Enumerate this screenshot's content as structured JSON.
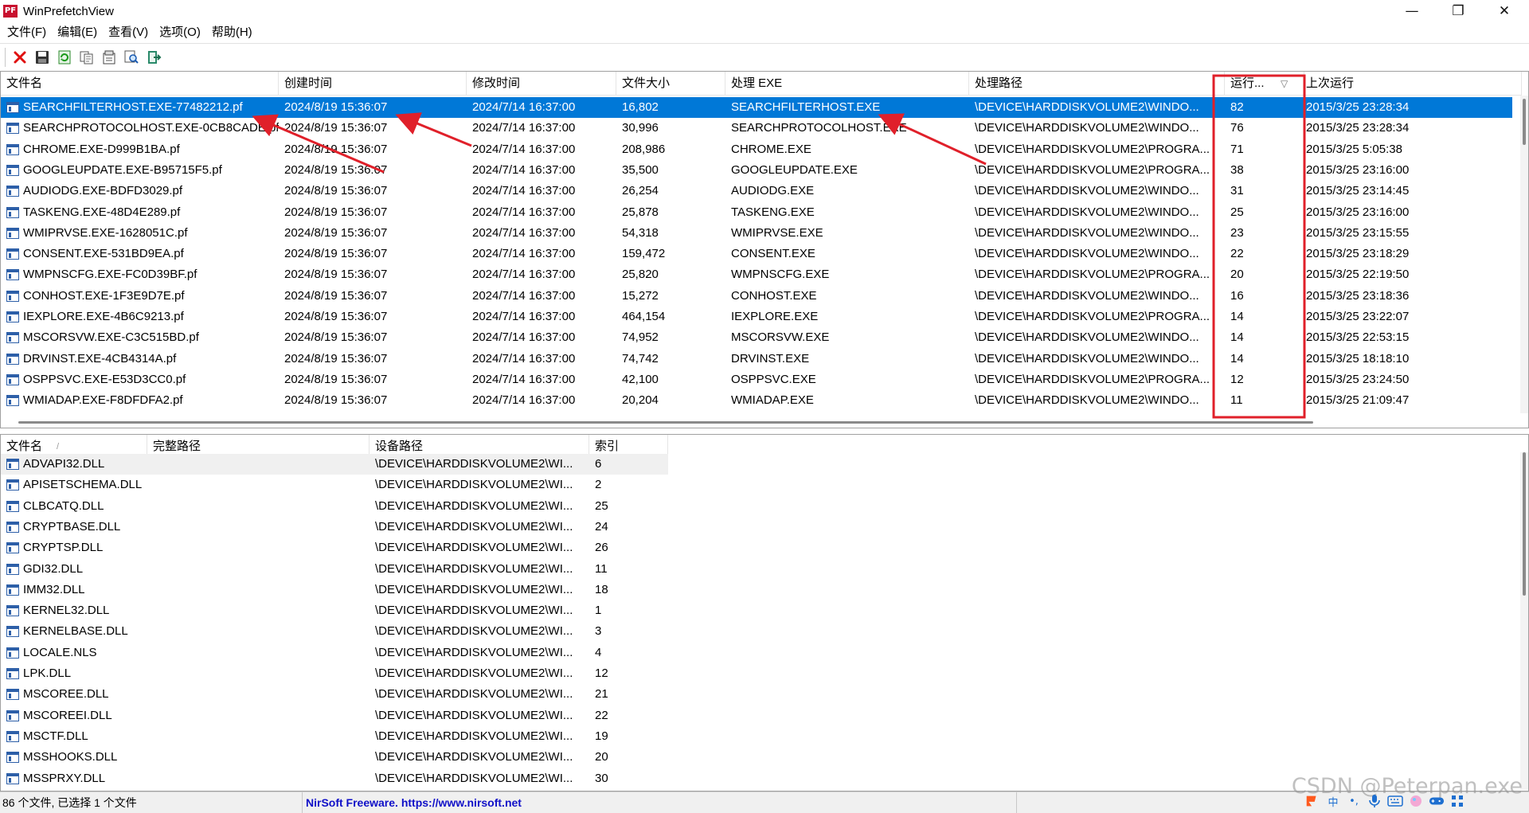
{
  "window": {
    "title": "WinPrefetchView",
    "icon_text": "PF",
    "controls": {
      "minimize": "—",
      "maximize": "❐",
      "close": "✕"
    }
  },
  "menu": [
    "文件(F)",
    "编辑(E)",
    "查看(V)",
    "选项(O)",
    "帮助(H)"
  ],
  "toolbar": {
    "buttons": [
      {
        "name": "delete-button",
        "icon": "red-x-icon"
      },
      {
        "name": "save-button",
        "icon": "save-icon"
      },
      {
        "name": "refresh-button",
        "icon": "refresh-icon"
      },
      {
        "name": "copy-button",
        "icon": "copy-icon"
      },
      {
        "name": "properties-button",
        "icon": "properties-icon"
      },
      {
        "name": "find-button",
        "icon": "find-icon"
      },
      {
        "name": "exit-button",
        "icon": "exit-icon"
      }
    ]
  },
  "prefetch_list": {
    "columns": [
      "文件名",
      "创建时间",
      "修改时间",
      "文件大小",
      "处理 EXE",
      "处理路径",
      "运行...",
      "上次运行"
    ],
    "sort_indicator": "▽",
    "rows": [
      [
        "SEARCHFILTERHOST.EXE-77482212.pf",
        "2024/8/19 15:36:07",
        "2024/7/14 16:37:00",
        "16,802",
        "SEARCHFILTERHOST.EXE",
        "\\DEVICE\\HARDDISKVOLUME2\\WINDO...",
        "82",
        "2015/3/25 23:28:34"
      ],
      [
        "SEARCHPROTOCOLHOST.EXE-0CB8CADE.pf",
        "2024/8/19 15:36:07",
        "2024/7/14 16:37:00",
        "30,996",
        "SEARCHPROTOCOLHOST.EXE",
        "\\DEVICE\\HARDDISKVOLUME2\\WINDO...",
        "76",
        "2015/3/25 23:28:34"
      ],
      [
        "CHROME.EXE-D999B1BA.pf",
        "2024/8/19 15:36:07",
        "2024/7/14 16:37:00",
        "208,986",
        "CHROME.EXE",
        "\\DEVICE\\HARDDISKVOLUME2\\PROGRA...",
        "71",
        "2015/3/25 5:05:38"
      ],
      [
        "GOOGLEUPDATE.EXE-B95715F5.pf",
        "2024/8/19 15:36:07",
        "2024/7/14 16:37:00",
        "35,500",
        "GOOGLEUPDATE.EXE",
        "\\DEVICE\\HARDDISKVOLUME2\\PROGRA...",
        "38",
        "2015/3/25 23:16:00"
      ],
      [
        "AUDIODG.EXE-BDFD3029.pf",
        "2024/8/19 15:36:07",
        "2024/7/14 16:37:00",
        "26,254",
        "AUDIODG.EXE",
        "\\DEVICE\\HARDDISKVOLUME2\\WINDO...",
        "31",
        "2015/3/25 23:14:45"
      ],
      [
        "TASKENG.EXE-48D4E289.pf",
        "2024/8/19 15:36:07",
        "2024/7/14 16:37:00",
        "25,878",
        "TASKENG.EXE",
        "\\DEVICE\\HARDDISKVOLUME2\\WINDO...",
        "25",
        "2015/3/25 23:16:00"
      ],
      [
        "WMIPRVSE.EXE-1628051C.pf",
        "2024/8/19 15:36:07",
        "2024/7/14 16:37:00",
        "54,318",
        "WMIPRVSE.EXE",
        "\\DEVICE\\HARDDISKVOLUME2\\WINDO...",
        "23",
        "2015/3/25 23:15:55"
      ],
      [
        "CONSENT.EXE-531BD9EA.pf",
        "2024/8/19 15:36:07",
        "2024/7/14 16:37:00",
        "159,472",
        "CONSENT.EXE",
        "\\DEVICE\\HARDDISKVOLUME2\\WINDO...",
        "22",
        "2015/3/25 23:18:29"
      ],
      [
        "WMPNSCFG.EXE-FC0D39BF.pf",
        "2024/8/19 15:36:07",
        "2024/7/14 16:37:00",
        "25,820",
        "WMPNSCFG.EXE",
        "\\DEVICE\\HARDDISKVOLUME2\\PROGRA...",
        "20",
        "2015/3/25 22:19:50"
      ],
      [
        "CONHOST.EXE-1F3E9D7E.pf",
        "2024/8/19 15:36:07",
        "2024/7/14 16:37:00",
        "15,272",
        "CONHOST.EXE",
        "\\DEVICE\\HARDDISKVOLUME2\\WINDO...",
        "16",
        "2015/3/25 23:18:36"
      ],
      [
        "IEXPLORE.EXE-4B6C9213.pf",
        "2024/8/19 15:36:07",
        "2024/7/14 16:37:00",
        "464,154",
        "IEXPLORE.EXE",
        "\\DEVICE\\HARDDISKVOLUME2\\PROGRA...",
        "14",
        "2015/3/25 23:22:07"
      ],
      [
        "MSCORSVW.EXE-C3C515BD.pf",
        "2024/8/19 15:36:07",
        "2024/7/14 16:37:00",
        "74,952",
        "MSCORSVW.EXE",
        "\\DEVICE\\HARDDISKVOLUME2\\WINDO...",
        "14",
        "2015/3/25 22:53:15"
      ],
      [
        "DRVINST.EXE-4CB4314A.pf",
        "2024/8/19 15:36:07",
        "2024/7/14 16:37:00",
        "74,742",
        "DRVINST.EXE",
        "\\DEVICE\\HARDDISKVOLUME2\\WINDO...",
        "14",
        "2015/3/25 18:18:10"
      ],
      [
        "OSPPSVC.EXE-E53D3CC0.pf",
        "2024/8/19 15:36:07",
        "2024/7/14 16:37:00",
        "42,100",
        "OSPPSVC.EXE",
        "\\DEVICE\\HARDDISKVOLUME2\\PROGRA...",
        "12",
        "2015/3/25 23:24:50"
      ],
      [
        "WMIADAP.EXE-F8DFDFA2.pf",
        "2024/8/19 15:36:07",
        "2024/7/14 16:37:00",
        "20,204",
        "WMIADAP.EXE",
        "\\DEVICE\\HARDDISKVOLUME2\\WINDO...",
        "11",
        "2015/3/25 21:09:47"
      ]
    ],
    "selected_index": 0
  },
  "file_list": {
    "columns": [
      "文件名",
      "完整路径",
      "设备路径",
      "索引"
    ],
    "sort_indicator": "/",
    "rows": [
      [
        "ADVAPI32.DLL",
        "",
        "\\DEVICE\\HARDDISKVOLUME2\\WI...",
        "6"
      ],
      [
        "APISETSCHEMA.DLL",
        "",
        "\\DEVICE\\HARDDISKVOLUME2\\WI...",
        "2"
      ],
      [
        "CLBCATQ.DLL",
        "",
        "\\DEVICE\\HARDDISKVOLUME2\\WI...",
        "25"
      ],
      [
        "CRYPTBASE.DLL",
        "",
        "\\DEVICE\\HARDDISKVOLUME2\\WI...",
        "24"
      ],
      [
        "CRYPTSP.DLL",
        "",
        "\\DEVICE\\HARDDISKVOLUME2\\WI...",
        "26"
      ],
      [
        "GDI32.DLL",
        "",
        "\\DEVICE\\HARDDISKVOLUME2\\WI...",
        "11"
      ],
      [
        "IMM32.DLL",
        "",
        "\\DEVICE\\HARDDISKVOLUME2\\WI...",
        "18"
      ],
      [
        "KERNEL32.DLL",
        "",
        "\\DEVICE\\HARDDISKVOLUME2\\WI...",
        "1"
      ],
      [
        "KERNELBASE.DLL",
        "",
        "\\DEVICE\\HARDDISKVOLUME2\\WI...",
        "3"
      ],
      [
        "LOCALE.NLS",
        "",
        "\\DEVICE\\HARDDISKVOLUME2\\WI...",
        "4"
      ],
      [
        "LPK.DLL",
        "",
        "\\DEVICE\\HARDDISKVOLUME2\\WI...",
        "12"
      ],
      [
        "MSCOREE.DLL",
        "",
        "\\DEVICE\\HARDDISKVOLUME2\\WI...",
        "21"
      ],
      [
        "MSCOREEI.DLL",
        "",
        "\\DEVICE\\HARDDISKVOLUME2\\WI...",
        "22"
      ],
      [
        "MSCTF.DLL",
        "",
        "\\DEVICE\\HARDDISKVOLUME2\\WI...",
        "19"
      ],
      [
        "MSSHOOKS.DLL",
        "",
        "\\DEVICE\\HARDDISKVOLUME2\\WI...",
        "20"
      ],
      [
        "MSSPRXY.DLL",
        "",
        "\\DEVICE\\HARDDISKVOLUME2\\WI...",
        "30"
      ]
    ],
    "highlighted_index": 0
  },
  "status": {
    "count_text": "86 个文件, 已选择 1 个文件",
    "link_text": "NirSoft Freeware. https://www.nirsoft.net"
  },
  "watermark": "CSDN @Peterpan.exe",
  "tray_icons": [
    "ime-logo-icon",
    "zh-ime-icon",
    "punctuation-icon",
    "microphone-icon",
    "keyboard-icon",
    "skin-icon",
    "gamepad-icon",
    "grid-menu-icon"
  ],
  "colors": {
    "selection": "#0078d7",
    "annotation_red": "#e0202a",
    "link": "#1010c8",
    "row_highlight": "#f0f0f0"
  }
}
